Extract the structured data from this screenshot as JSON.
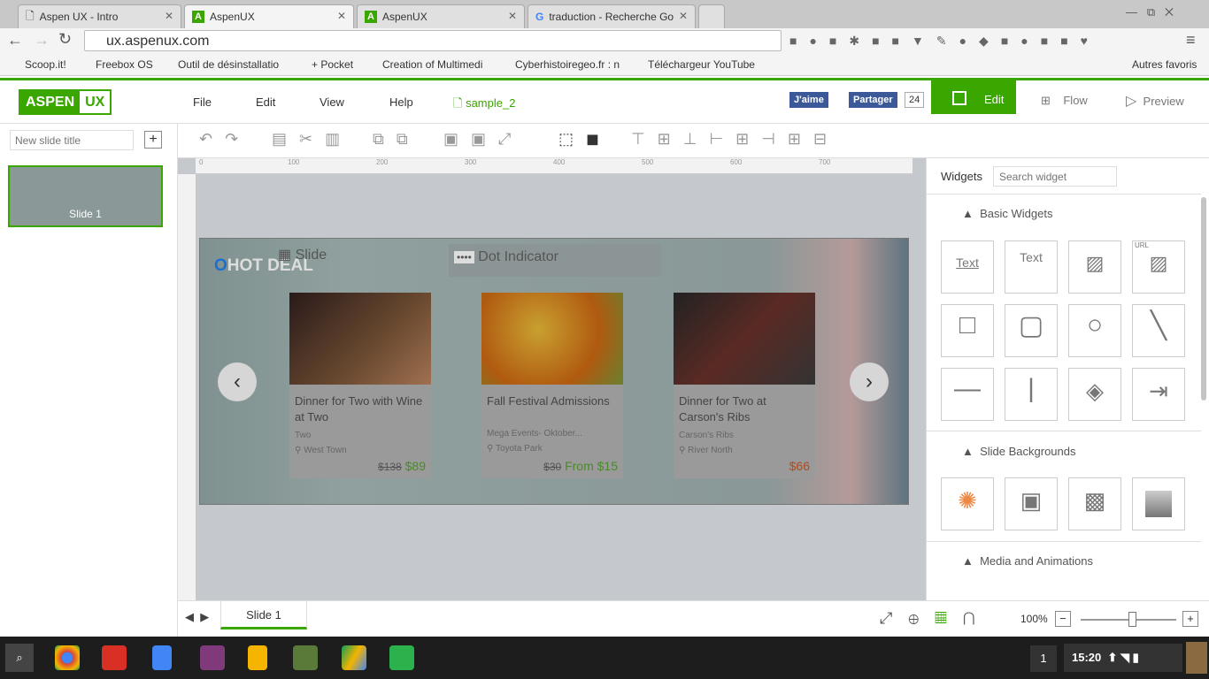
{
  "browser": {
    "tabs": [
      {
        "title": "Aspen UX - Intro"
      },
      {
        "title": "AspenUX",
        "active": true
      },
      {
        "title": "AspenUX"
      },
      {
        "title": "traduction - Recherche Go"
      }
    ],
    "url": "ux.aspenux.com",
    "bookmarks": [
      "Scoop.it!",
      "Freebox OS",
      "Outil de désinstallatio",
      "+ Pocket",
      "Creation of Multimedi",
      "Cyberhistoiregeo.fr : n",
      "Téléchargeur YouTube"
    ],
    "other_bookmarks": "Autres favoris"
  },
  "app": {
    "logo_left": "ASPEN",
    "logo_right": "UX",
    "menu": [
      "File",
      "Edit",
      "View",
      "Help"
    ],
    "file_name": "sample_2",
    "fb_like": "J'aime",
    "fb_share": "Partager",
    "share_count": "24",
    "modes": {
      "edit": "Edit",
      "flow": "Flow",
      "preview": "Preview"
    },
    "accent": "#3aa600"
  },
  "left_panel": {
    "new_slide_placeholder": "New slide title",
    "add": "+",
    "slides": [
      {
        "label": "Slide 1"
      }
    ]
  },
  "ruler": [
    "0",
    "100",
    "200",
    "300",
    "400",
    "500",
    "600",
    "700"
  ],
  "slide": {
    "badge": "HOT DEAL",
    "slide_label": "Slide",
    "dot_indicator": "Dot Indicator",
    "cards": [
      {
        "title": "Dinner for Two with Wine at Two",
        "sub": "Two",
        "location": "West Town",
        "old_price": "$138",
        "price": "$89"
      },
      {
        "title": "Fall Festival Admissions",
        "sub": "Mega Events- Oktober...",
        "location": "Toyota Park",
        "old_price": "$30",
        "price": "From $15"
      },
      {
        "title": "Dinner for Two at Carson's Ribs",
        "sub": "Carson's Ribs",
        "location": "River North",
        "old_price": "",
        "price": "$66"
      }
    ]
  },
  "widgets": {
    "title": "Widgets",
    "search_placeholder": "Search widget",
    "sections": [
      {
        "name": "Basic Widgets"
      },
      {
        "name": "Slide Backgrounds"
      },
      {
        "name": "Media and Animations"
      }
    ],
    "basic": [
      "Text",
      "Text",
      "image",
      "URL",
      "square",
      "rounded-square",
      "circle",
      "diagonal-line",
      "horizontal-line",
      "vertical-line",
      "layers",
      "interaction"
    ],
    "url_label": "URL"
  },
  "bottom": {
    "tab": "Slide 1",
    "zoom": "100%",
    "zoom_value": 50
  },
  "taskbar": {
    "count": "1",
    "time": "15:20"
  }
}
